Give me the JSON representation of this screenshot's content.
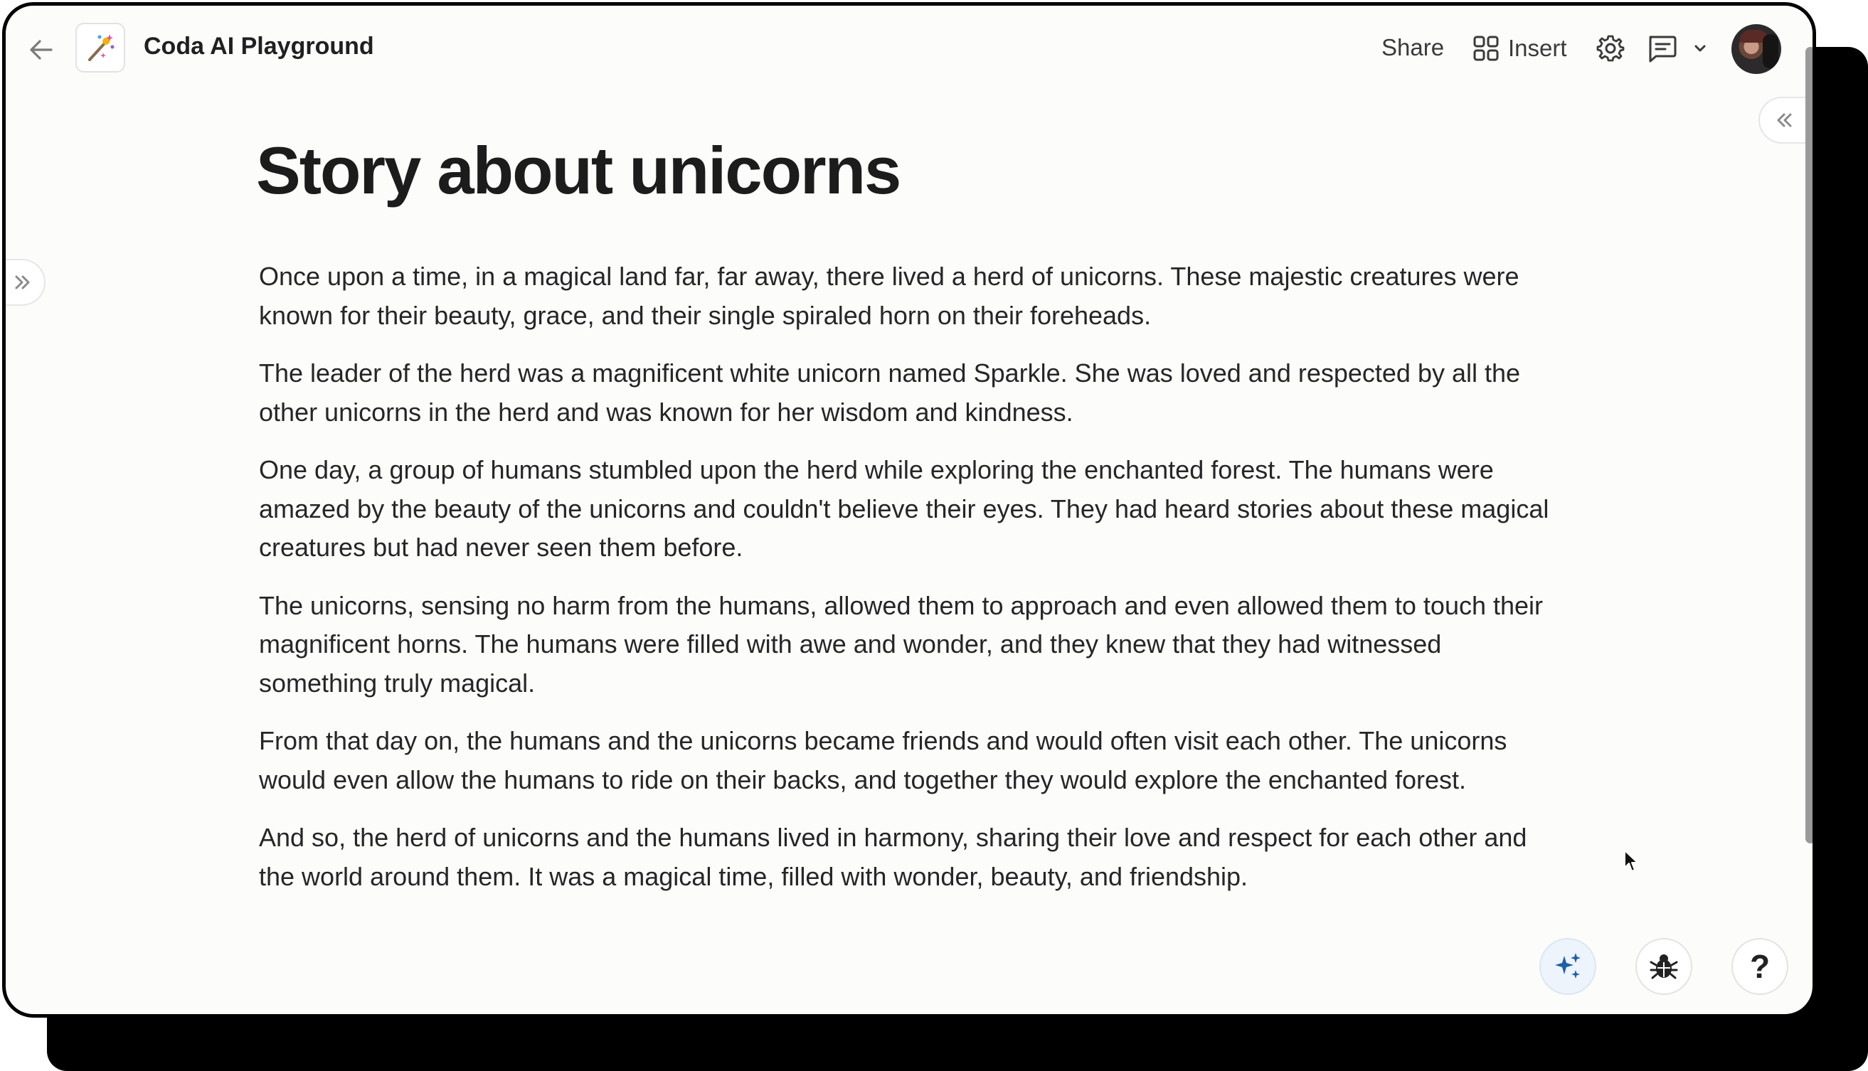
{
  "header": {
    "doc_title": "Coda AI Playground",
    "share_label": "Share",
    "insert_label": "Insert",
    "icons": [
      "back-arrow-icon",
      "magic-wand-icon",
      "insert-grid-icon",
      "gear-icon",
      "comment-icon",
      "chevron-down-icon"
    ]
  },
  "page": {
    "title": "Story about unicorns",
    "paragraphs": [
      "Once upon a time, in a magical land far, far away, there lived a herd of unicorns. These majestic creatures were known for their beauty, grace, and their single spiraled horn on their foreheads.",
      "The leader of the herd was a magnificent white unicorn named Sparkle. She was loved and respected by all the other unicorns in the herd and was known for her wisdom and kindness.",
      "One day, a group of humans stumbled upon the herd while exploring the enchanted forest. The humans were amazed by the beauty of the unicorns and couldn't believe their eyes. They had heard stories about these magical creatures but had never seen them before.",
      "The unicorns, sensing no harm from the humans, allowed them to approach and even allowed them to touch their magnificent horns. The humans were filled with awe and wonder, and they knew that they had witnessed something truly magical.",
      "From that day on, the humans and the unicorns became friends and would often visit each other. The unicorns would even allow the humans to ride on their backs, and together they would explore the enchanted forest.",
      "And so, the herd of unicorns and the humans lived in harmony, sharing their love and respect for each other and the world around them. It was a magical time, filled with wonder, beauty, and friendship."
    ]
  },
  "floating_buttons": {
    "help_label": "?",
    "icons": [
      "sparkle-ai-icon",
      "bug-icon"
    ]
  },
  "colors": {
    "ai_accent": "#1f5fa8",
    "background": "#fcfcfb"
  }
}
